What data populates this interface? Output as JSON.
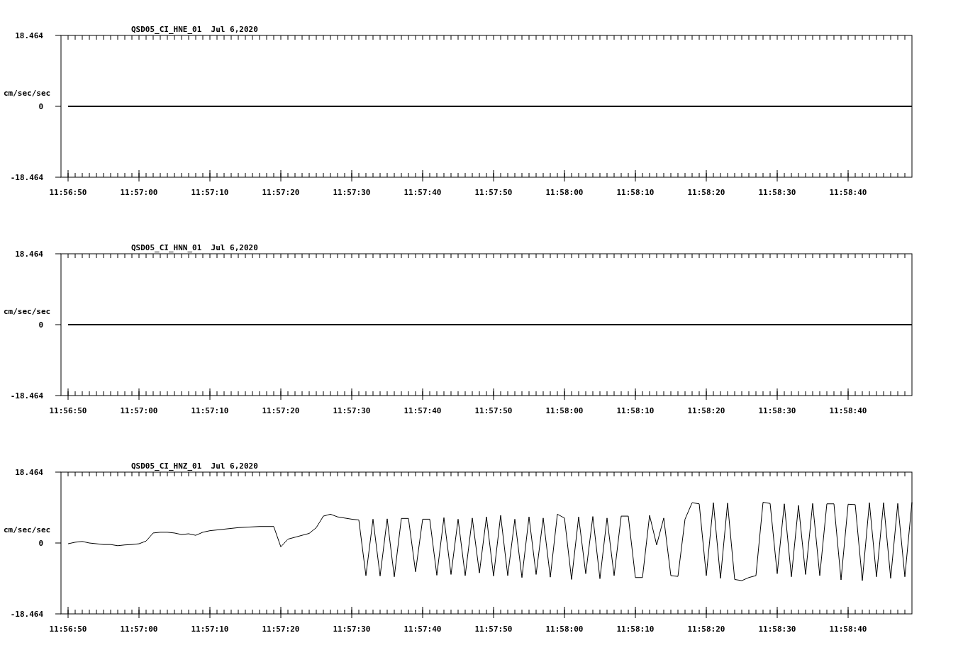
{
  "charts": [
    {
      "chart_data": {
        "type": "line",
        "title": "QSD05_CI_HNE_01  Jul 6,2020",
        "ylabel": "cm/sec/sec",
        "categories": [
          "11:56:50",
          null,
          null,
          null,
          null,
          null,
          null,
          null,
          null,
          null,
          "11:57:00",
          null,
          null,
          null,
          null,
          null,
          null,
          null,
          null,
          null,
          "11:57:10",
          null,
          null,
          null,
          null,
          null,
          null,
          null,
          null,
          null,
          "11:57:20",
          null,
          null,
          null,
          null,
          null,
          null,
          null,
          null,
          null,
          "11:57:30",
          null,
          null,
          null,
          null,
          null,
          null,
          null,
          null,
          null,
          "11:57:40",
          null,
          null,
          null,
          null,
          null,
          null,
          null,
          null,
          null,
          "11:57:50",
          null,
          null,
          null,
          null,
          null,
          null,
          null,
          null,
          null,
          "11:58:00",
          null,
          null,
          null,
          null,
          null,
          null,
          null,
          null,
          null,
          "11:58:10",
          null,
          null,
          null,
          null,
          null,
          null,
          null,
          null,
          null,
          "11:58:20",
          null,
          null,
          null,
          null,
          null,
          null,
          null,
          null,
          null,
          "11:58:30",
          null,
          null,
          null,
          null,
          null,
          null,
          null,
          null,
          null,
          "11:58:40",
          null,
          null,
          null,
          null,
          null,
          null,
          null,
          null,
          null
        ],
        "series": [
          {
            "color": "#000000",
            "values": [
              0,
              0,
              0,
              0,
              0,
              0,
              0,
              0,
              0,
              0,
              0,
              0,
              0,
              0,
              0,
              0,
              0,
              0,
              0,
              0,
              0,
              0,
              0,
              0,
              0,
              0,
              0,
              0,
              0,
              0,
              0,
              0,
              0,
              0,
              0,
              0,
              0,
              0,
              0,
              0,
              0,
              0,
              0,
              0,
              0,
              0,
              0,
              0,
              0,
              0,
              0,
              0,
              0,
              0,
              0,
              0,
              0,
              0,
              0,
              0,
              0,
              0,
              0,
              0,
              0,
              0,
              0,
              0,
              0,
              0,
              0,
              0,
              0,
              0,
              0,
              0,
              0,
              0,
              0,
              0,
              0,
              0,
              0,
              0,
              0,
              0,
              0,
              0,
              0,
              0,
              0,
              0,
              0,
              0,
              0,
              0,
              0,
              0,
              0,
              0,
              0,
              0,
              0,
              0,
              0,
              0,
              0,
              0,
              0,
              0,
              0,
              0,
              0,
              0,
              0,
              0,
              0,
              0,
              0,
              0
            ]
          }
        ],
        "ylim": [
          -18.464,
          18.464
        ],
        "yticks": [
          {
            "value": 18.464,
            "label": "18.464"
          },
          {
            "value": 0,
            "label": "0"
          },
          {
            "value": -18.464,
            "label": "-18.464"
          }
        ]
      }
    },
    {
      "chart_data": {
        "type": "line",
        "title": "QSD05_CI_HNN_01  Jul 6,2020",
        "ylabel": "cm/sec/sec",
        "categories": [
          "11:56:50",
          null,
          null,
          null,
          null,
          null,
          null,
          null,
          null,
          null,
          "11:57:00",
          null,
          null,
          null,
          null,
          null,
          null,
          null,
          null,
          null,
          "11:57:10",
          null,
          null,
          null,
          null,
          null,
          null,
          null,
          null,
          null,
          "11:57:20",
          null,
          null,
          null,
          null,
          null,
          null,
          null,
          null,
          null,
          "11:57:30",
          null,
          null,
          null,
          null,
          null,
          null,
          null,
          null,
          null,
          "11:57:40",
          null,
          null,
          null,
          null,
          null,
          null,
          null,
          null,
          null,
          "11:57:50",
          null,
          null,
          null,
          null,
          null,
          null,
          null,
          null,
          null,
          "11:58:00",
          null,
          null,
          null,
          null,
          null,
          null,
          null,
          null,
          null,
          "11:58:10",
          null,
          null,
          null,
          null,
          null,
          null,
          null,
          null,
          null,
          "11:58:20",
          null,
          null,
          null,
          null,
          null,
          null,
          null,
          null,
          null,
          "11:58:30",
          null,
          null,
          null,
          null,
          null,
          null,
          null,
          null,
          null,
          "11:58:40",
          null,
          null,
          null,
          null,
          null,
          null,
          null,
          null,
          null
        ],
        "series": [
          {
            "color": "#000000",
            "values": [
              0,
              0,
              0,
              0,
              0,
              0,
              0,
              0,
              0,
              0,
              0,
              0,
              0,
              0,
              0,
              0,
              0,
              0,
              0,
              0,
              0,
              0,
              0,
              0,
              0,
              0,
              0,
              0,
              0,
              0,
              0,
              0,
              0,
              0,
              0,
              0,
              0,
              0,
              0,
              0,
              0,
              0,
              0,
              0,
              0,
              0,
              0,
              0,
              0,
              0,
              0,
              0,
              0,
              0,
              0,
              0,
              0,
              0,
              0,
              0,
              0,
              0,
              0,
              0,
              0,
              0,
              0,
              0,
              0,
              0,
              0,
              0,
              0,
              0,
              0,
              0,
              0,
              0,
              0,
              0,
              0,
              0,
              0,
              0,
              0,
              0,
              0,
              0,
              0,
              0,
              0,
              0,
              0,
              0,
              0,
              0,
              0,
              0,
              0,
              0,
              0,
              0,
              0,
              0,
              0,
              0,
              0,
              0,
              0,
              0,
              0,
              0,
              0,
              0,
              0,
              0,
              0,
              0,
              0,
              0
            ]
          }
        ],
        "ylim": [
          -18.464,
          18.464
        ],
        "yticks": [
          {
            "value": 18.464,
            "label": "18.464"
          },
          {
            "value": 0,
            "label": "0"
          },
          {
            "value": -18.464,
            "label": "-18.464"
          }
        ]
      }
    },
    {
      "chart_data": {
        "type": "line",
        "title": "QSD05_CI_HNZ_01  Jul 6,2020",
        "ylabel": "cm/sec/sec",
        "categories": [
          "11:56:50",
          null,
          null,
          null,
          null,
          null,
          null,
          null,
          null,
          null,
          "11:57:00",
          null,
          null,
          null,
          null,
          null,
          null,
          null,
          null,
          null,
          "11:57:10",
          null,
          null,
          null,
          null,
          null,
          null,
          null,
          null,
          null,
          "11:57:20",
          null,
          null,
          null,
          null,
          null,
          null,
          null,
          null,
          null,
          "11:57:30",
          null,
          null,
          null,
          null,
          null,
          null,
          null,
          null,
          null,
          "11:57:40",
          null,
          null,
          null,
          null,
          null,
          null,
          null,
          null,
          null,
          "11:57:50",
          null,
          null,
          null,
          null,
          null,
          null,
          null,
          null,
          null,
          "11:58:00",
          null,
          null,
          null,
          null,
          null,
          null,
          null,
          null,
          null,
          "11:58:10",
          null,
          null,
          null,
          null,
          null,
          null,
          null,
          null,
          null,
          "11:58:20",
          null,
          null,
          null,
          null,
          null,
          null,
          null,
          null,
          null,
          "11:58:30",
          null,
          null,
          null,
          null,
          null,
          null,
          null,
          null,
          null,
          "11:58:40",
          null,
          null,
          null,
          null,
          null,
          null,
          null,
          null,
          null
        ],
        "series": [
          {
            "color": "#000000",
            "values": [
              -0.2,
              0.2,
              0.4,
              0,
              -0.2,
              -0.4,
              -0.4,
              -0.7,
              -0.5,
              -0.4,
              -0.2,
              0.5,
              2.6,
              2.8,
              2.8,
              2.6,
              2.2,
              2.4,
              2.0,
              2.8,
              3.2,
              3.4,
              3.6,
              3.8,
              4.0,
              4.1,
              4.2,
              4.3,
              4.3,
              4.3,
              -1.0,
              1.0,
              1.5,
              2.0,
              2.5,
              4.0,
              7.0,
              7.5,
              6.8,
              6.5,
              6.2,
              6.0,
              -8.5,
              6.2,
              -8.6,
              6.3,
              -8.8,
              6.4,
              6.4,
              -7.5,
              6.2,
              6.2,
              -8.4,
              6.6,
              -8.2,
              6.2,
              -8.5,
              6.5,
              -7.8,
              6.8,
              -8.6,
              7.2,
              -8.5,
              6.2,
              -9.0,
              6.8,
              -8.2,
              6.5,
              -8.9,
              7.5,
              6.5,
              -9.5,
              6.8,
              -8.0,
              6.9,
              -9.3,
              6.5,
              -8.5,
              7.0,
              7.0,
              -9.0,
              -9.0,
              7.2,
              -0.5,
              6.5,
              -8.5,
              -8.7,
              6.2,
              10.5,
              10.2,
              -8.5,
              10.5,
              -9.2,
              10.4,
              -9.5,
              -9.8,
              -9.0,
              -8.5,
              10.6,
              10.3,
              -8.0,
              10.2,
              -8.8,
              9.8,
              -8.2,
              10.3,
              -8.5,
              10.2,
              10.2,
              -9.6,
              10.1,
              10.0,
              -9.8,
              10.5,
              -8.8,
              10.5,
              -9.2,
              10.3,
              -8.8,
              10.6
            ]
          }
        ],
        "ylim": [
          -18.464,
          18.464
        ],
        "yticks": [
          {
            "value": 18.464,
            "label": "18.464"
          },
          {
            "value": 0,
            "label": "0"
          },
          {
            "value": -18.464,
            "label": "-18.464"
          }
        ]
      }
    }
  ]
}
